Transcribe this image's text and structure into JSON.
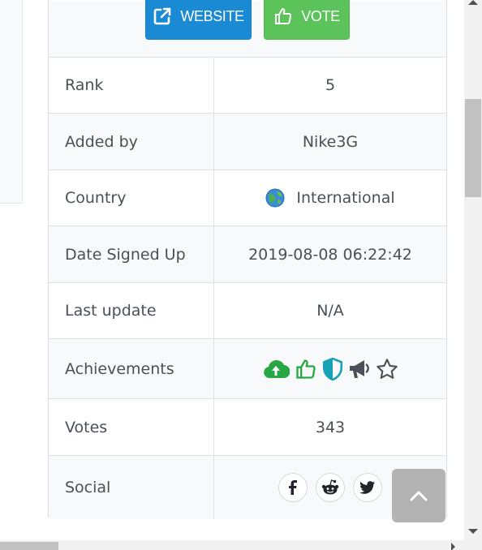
{
  "actions": {
    "website_label": "WEBSITE",
    "vote_label": "VOTE",
    "website_color": "#1b8ad4",
    "vote_color": "#5bc35a",
    "website_icon": "external-link-icon",
    "vote_icon": "thumbs-up-icon"
  },
  "rows": {
    "rank": {
      "label": "Rank",
      "value": "5"
    },
    "added_by": {
      "label": "Added by",
      "value": "Nike3G"
    },
    "country": {
      "label": "Country",
      "value": "International",
      "icon": "globe-icon"
    },
    "date_signed_up": {
      "label": "Date Signed Up",
      "value": "2019-08-08 06:22:42"
    },
    "last_update": {
      "label": "Last update",
      "value": "N/A"
    },
    "achievements": {
      "label": "Achievements",
      "icons": [
        "cloud-upload-icon",
        "thumbs-up-icon",
        "shield-icon",
        "megaphone-icon",
        "star-icon"
      ],
      "colors": [
        "#28a745",
        "#28a745",
        "#17a2b8",
        "#495057",
        "#495057"
      ]
    },
    "votes": {
      "label": "Votes",
      "value": "343"
    },
    "social": {
      "label": "Social",
      "icons": [
        "facebook-icon",
        "reddit-icon",
        "twitter-icon"
      ]
    }
  },
  "back_to_top_icon": "chevron-up-icon"
}
